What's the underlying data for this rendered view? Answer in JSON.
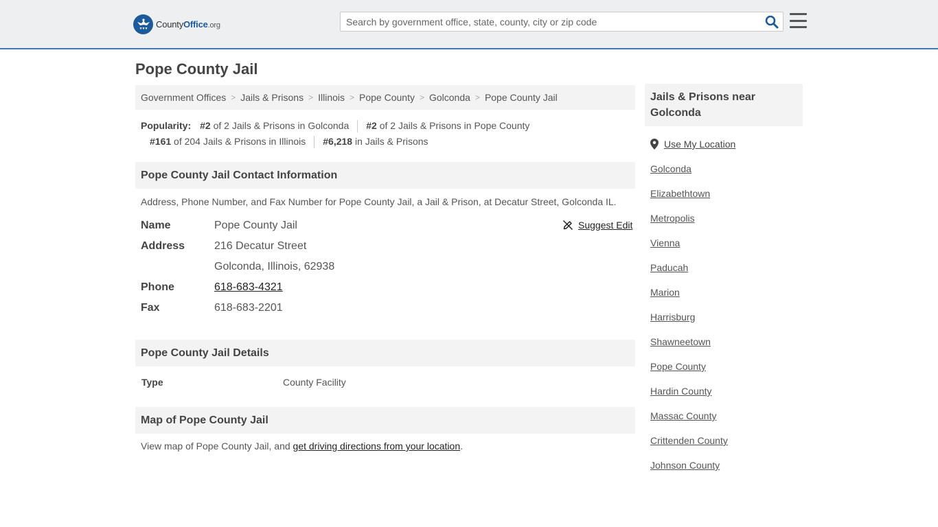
{
  "header": {
    "logo_brand_pre": "County",
    "logo_brand_bold": "Office",
    "logo_tld": ".org",
    "search_placeholder": "Search by government office, state, county, city or zip code"
  },
  "page": {
    "title": "Pope County Jail"
  },
  "breadcrumb": [
    "Government Offices",
    "Jails & Prisons",
    "Illinois",
    "Pope County",
    "Golconda",
    "Pope County Jail"
  ],
  "popularity": {
    "label": "Popularity:",
    "items": [
      {
        "rank": "#2",
        "text": " of 2 Jails & Prisons in Golconda"
      },
      {
        "rank": "#2",
        "text": " of 2 Jails & Prisons in Pope County"
      },
      {
        "rank": "#161",
        "text": " of 204 Jails & Prisons in Illinois"
      },
      {
        "rank": "#6,218",
        "text": " in Jails & Prisons"
      }
    ]
  },
  "contact": {
    "heading": "Pope County Jail Contact Information",
    "description": "Address, Phone Number, and Fax Number for Pope County Jail, a Jail & Prison, at Decatur Street, Golconda IL.",
    "suggest_edit": "Suggest Edit",
    "name_label": "Name",
    "name_value": "Pope County Jail",
    "address_label": "Address",
    "address_line1": "216 Decatur Street",
    "address_line2": "Golconda, Illinois, 62938",
    "phone_label": "Phone",
    "phone_value": "618-683-4321",
    "fax_label": "Fax",
    "fax_value": "618-683-2201"
  },
  "details": {
    "heading": "Pope County Jail Details",
    "type_label": "Type",
    "type_value": "County Facility"
  },
  "map": {
    "heading": "Map of Pope County Jail",
    "text_before": "View map of Pope County Jail, and ",
    "link_text": "get driving directions from your location",
    "text_after": "."
  },
  "sidebar": {
    "heading": "Jails & Prisons near Golconda",
    "use_location": "Use My Location",
    "links": [
      "Golconda",
      "Elizabethtown",
      "Metropolis",
      "Vienna",
      "Paducah",
      "Marion",
      "Harrisburg",
      "Shawneetown",
      "Pope County",
      "Hardin County",
      "Massac County",
      "Crittenden County",
      "Johnson County"
    ]
  },
  "colors": {
    "accent": "#1d5a99",
    "header_bg": "#eeeff0",
    "panel_bg": "#f3f3f3"
  }
}
